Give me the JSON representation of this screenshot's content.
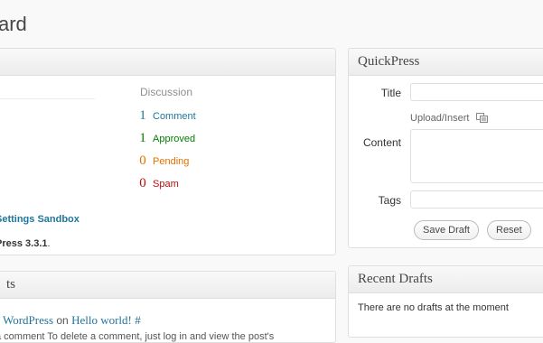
{
  "page": {
    "title": "ard"
  },
  "right_now": {
    "title": "",
    "discussion_header": "Discussion",
    "discussion": [
      {
        "count": "1",
        "label": "Comment",
        "color": "#21759b"
      },
      {
        "count": "1",
        "label": "Approved",
        "color": "#008000"
      },
      {
        "count": "0",
        "label": "Pending",
        "color": "#e66f00"
      },
      {
        "count": "0",
        "label": "Spam",
        "color": "#bc0b0b"
      }
    ],
    "theme_text": "Settings Sandbox",
    "version_text": "Press 3.3.1",
    "version_suffix": "."
  },
  "recent_comments": {
    "title": "ts",
    "author": "WordPress",
    "on_text": "on",
    "post_link": "Hello world!",
    "hash": "#",
    "excerpt": "a comment To delete a comment, just log in and view the post's"
  },
  "quickpress": {
    "title": "QuickPress",
    "title_label": "Title",
    "upload_label": "Upload/Insert",
    "content_label": "Content",
    "tags_label": "Tags",
    "title_value": "",
    "tags_value": "",
    "save_draft_label": "Save Draft",
    "reset_label": "Reset"
  },
  "recent_drafts": {
    "title": "Recent Drafts",
    "empty_text": "There are no drafts at the moment"
  }
}
